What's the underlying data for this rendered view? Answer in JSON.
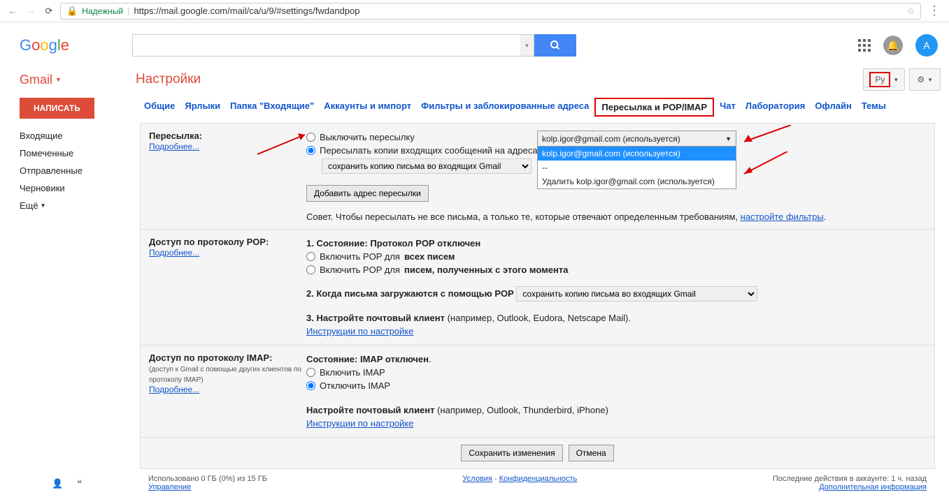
{
  "browser": {
    "secure": "Надежный",
    "url": "https://mail.google.com/mail/ca/u/9/#settings/fwdandpop"
  },
  "logo": {
    "g1": "G",
    "o1": "o",
    "o2": "o",
    "g2": "g",
    "l": "l",
    "e": "e"
  },
  "header": {
    "avatar": "А"
  },
  "gmail_label": "Gmail",
  "settings_title": "Настройки",
  "lang_btn": "Ру",
  "sidebar": {
    "compose": "НАПИСАТЬ",
    "items": [
      "Входящие",
      "Помеченные",
      "Отправленные",
      "Черновики"
    ],
    "more": "Ещё"
  },
  "tabs": [
    "Общие",
    "Ярлыки",
    "Папка \"Входящие\"",
    "Аккаунты и импорт",
    "Фильтры и заблокированные адреса",
    "Пересылка и POP/IMAP",
    "Чат",
    "Лаборатория",
    "Офлайн",
    "Темы"
  ],
  "active_tab": 5,
  "fwd": {
    "label": "Пересылка:",
    "learn": "Подробнее...",
    "opt1": "Выключить пересылку",
    "opt2": "Пересылать копии входящих сообщений на адреса",
    "keep": "сохранить копию письма во входящих Gmail",
    "combo_selected": "kolp.igor@gmail.com (используется)",
    "combo_items": [
      "kolp.igor@gmail.com (используется)",
      "--",
      "Удалить kolp.igor@gmail.com (используется)"
    ],
    "add_btn": "Добавить адрес пересылки",
    "tip_before": "Совет. Чтобы пересылать не все письма, а только те, которые отвечают определенным требованиям, ",
    "tip_link": "настройте фильтры",
    "tip_after": "."
  },
  "pop": {
    "label": "Доступ по протоколу POP:",
    "learn": "Подробнее...",
    "status_b": "1. Состояние: ",
    "status": "Протокол POP отключен",
    "opt1a": "Включить POP для ",
    "opt1b": "всех писем",
    "opt2a": "Включить POP для ",
    "opt2b": "писем, полученных с этого момента",
    "l2b": "2. Когда письма загружаются с помощью POP",
    "l2sel": "сохранить копию письма во входящих Gmail",
    "l3b": "3. Настройте почтовый клиент ",
    "l3": "(например, Outlook, Eudora, Netscape Mail).",
    "instr": "Инструкции по настройке"
  },
  "imap": {
    "label": "Доступ по протоколу IMAP:",
    "sub": "(доступ к Gmail с помощью других клиентов по протоколу IMAP)",
    "learn": "Подробнее...",
    "status_b": "Состояние: ",
    "status": "IMAP отключен",
    "status_dot": ".",
    "opt1": "Включить IMAP",
    "opt2": "Отключить IMAP",
    "cfg_b": "Настройте почтовый клиент ",
    "cfg": "(например, Outlook, Thunderbird, iPhone)",
    "instr": "Инструкции по настройке"
  },
  "buttons": {
    "save": "Сохранить изменения",
    "cancel": "Отмена"
  },
  "footer": {
    "left1": "Использовано 0 ГБ (0%) из 15 ГБ",
    "left2": "Управление",
    "mid1": "Условия",
    "mid_sep": " - ",
    "mid2": "Конфиденциальность",
    "right1": "Последние действия в аккаунте: 1 ч. назад",
    "right2": "Дополнительная информация"
  }
}
